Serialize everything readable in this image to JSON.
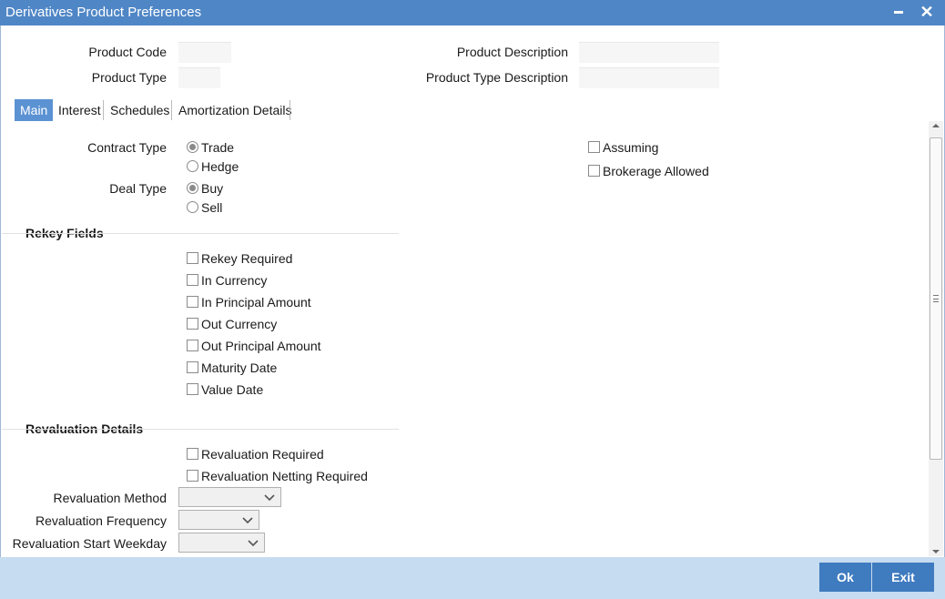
{
  "window": {
    "title": "Derivatives Product Preferences",
    "minimize_symbol": "▬",
    "close_symbol": "✕"
  },
  "header": {
    "product_code_label": "Product Code",
    "product_code_value": "",
    "product_type_label": "Product Type",
    "product_type_value": "",
    "product_description_label": "Product Description",
    "product_description_value": "",
    "product_type_description_label": "Product Type Description",
    "product_type_description_value": ""
  },
  "tabs": [
    {
      "label": "Main",
      "active": true
    },
    {
      "label": "Interest",
      "active": false
    },
    {
      "label": "Schedules",
      "active": false
    },
    {
      "label": "Amortization Details",
      "active": false
    }
  ],
  "main": {
    "contract_type_label": "Contract Type",
    "contract_type_options": [
      {
        "label": "Trade",
        "checked": true
      },
      {
        "label": "Hedge",
        "checked": false
      }
    ],
    "deal_type_label": "Deal Type",
    "deal_type_options": [
      {
        "label": "Buy",
        "checked": true
      },
      {
        "label": "Sell",
        "checked": false
      }
    ],
    "assuming_label": "Assuming",
    "assuming_checked": false,
    "brokerage_allowed_label": "Brokerage Allowed",
    "brokerage_allowed_checked": false
  },
  "rekey": {
    "section_title": "Rekey Fields",
    "items": [
      {
        "label": "Rekey Required",
        "checked": false
      },
      {
        "label": "In Currency",
        "checked": false
      },
      {
        "label": "In Principal Amount",
        "checked": false
      },
      {
        "label": "Out Currency",
        "checked": false
      },
      {
        "label": "Out Principal Amount",
        "checked": false
      },
      {
        "label": "Maturity Date",
        "checked": false
      },
      {
        "label": "Value Date",
        "checked": false
      }
    ]
  },
  "revaluation": {
    "section_title": "Revaluation Details",
    "required_label": "Revaluation Required",
    "required_checked": false,
    "netting_label": "Revaluation Netting Required",
    "netting_checked": false,
    "method_label": "Revaluation Method",
    "method_value": "",
    "frequency_label": "Revaluation Frequency",
    "frequency_value": "",
    "start_weekday_label": "Revaluation Start Weekday",
    "start_weekday_value": ""
  },
  "footer": {
    "ok_label": "Ok",
    "exit_label": "Exit"
  },
  "colors": {
    "titlebar": "#4f86c6",
    "active_tab": "#5b92d3",
    "footer": "#c6dcf0",
    "button": "#3f7bbf"
  }
}
